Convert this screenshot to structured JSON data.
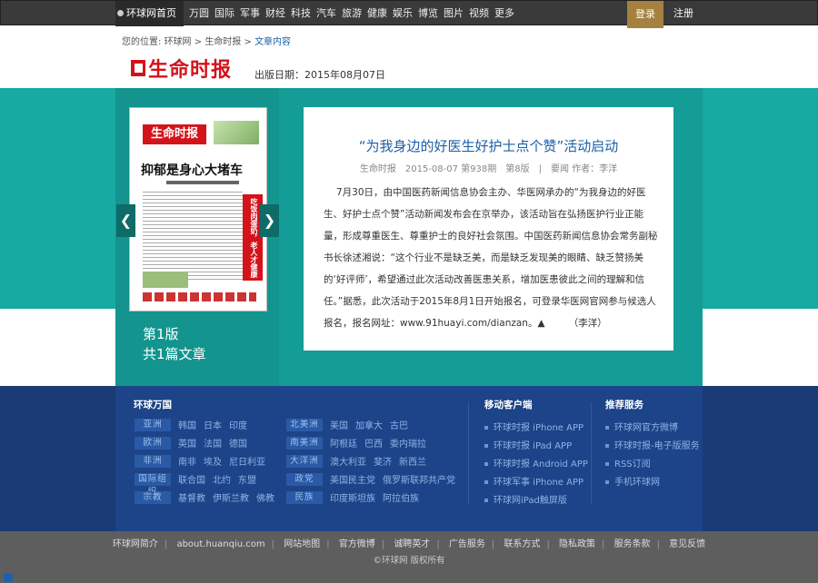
{
  "topbar": {
    "home": "环球网首页",
    "nav": [
      "万圆",
      "国际",
      "军事",
      "财经",
      "科技",
      "汽车",
      "旅游",
      "健康",
      "娱乐",
      "博览",
      "图片",
      "视频"
    ],
    "more": "更多",
    "login": "登录",
    "register": "注册"
  },
  "breadcrumb": {
    "prefix": "您的位置:",
    "items": [
      "环球网",
      "生命时报",
      "文章内容"
    ]
  },
  "logo_text": "生命时报",
  "pubdate": "出版日期：2015年08月07日",
  "paper": {
    "masthead": "生命时报",
    "headline": "抑郁是身心大堵车",
    "redbox": "吃饭肉蛋奶，老人才健康"
  },
  "edition": {
    "page": "第1版",
    "count": "共1篇文章"
  },
  "article": {
    "title": "“为我身边的好医生好护士点个赞”活动启动",
    "meta": "生命时报　2015-08-07 第938期　第8版　|　要闻 作者：李洋",
    "body": "7月30日，由中国医药新闻信息协会主办、华医网承办的“为我身边的好医生、好护士点个赞”活动新闻发布会在京举办，该活动旨在弘扬医护行业正能量，形成尊重医生、尊重护士的良好社会氛围。中国医药新闻信息协会常务副秘书长徐述湘说：“这个行业不是缺乏美，而是缺乏发现美的眼睛、缺乏赞扬美的‘好评师’，希望通过此次活动改善医患关系，增加医患彼此之间的理解和信任。”据悉，此次活动于2015年8月1日开始报名，可登录华医网官网参与候选人报名，报名网址：www.91huayi.com/dianzan。▲　　　（李洋）"
  },
  "footer": {
    "world": {
      "title": "环球万国",
      "rows": [
        {
          "tag": "亚洲",
          "items": [
            "韩国",
            "日本",
            "印度"
          ]
        },
        {
          "tag": "欧洲",
          "items": [
            "英国",
            "法国",
            "德国"
          ]
        },
        {
          "tag": "非洲",
          "items": [
            "南非",
            "埃及",
            "尼日利亚"
          ]
        },
        {
          "tag": "国际组织",
          "items": [
            "联合国",
            "北约",
            "东盟"
          ]
        },
        {
          "tag": "宗教",
          "items": [
            "基督教",
            "伊斯兰教",
            "佛教"
          ]
        }
      ],
      "rows2": [
        {
          "tag": "北美洲",
          "items": [
            "美国",
            "加拿大",
            "古巴"
          ]
        },
        {
          "tag": "南美洲",
          "items": [
            "阿根廷",
            "巴西",
            "委内瑞拉"
          ]
        },
        {
          "tag": "大洋洲",
          "items": [
            "澳大利亚",
            "斐济",
            "新西兰"
          ]
        },
        {
          "tag": "政党",
          "items": [
            "美国民主党",
            "俄罗斯联邦共产党"
          ]
        },
        {
          "tag": "民族",
          "items": [
            "印度斯坦族",
            "阿拉伯族"
          ]
        }
      ]
    },
    "mobile": {
      "title": "移动客户端",
      "items": [
        "环球时报 iPhone APP",
        "环球时报 iPad APP",
        "环球时报 Android APP",
        "环球军事 iPhone APP",
        "环球网iPad触屏版"
      ]
    },
    "recommend": {
      "title": "推荐服务",
      "items": [
        "环球网官方微博",
        "环球时报-电子版服务",
        "RSS订阅",
        "手机环球网"
      ]
    }
  },
  "bottom": {
    "links": [
      "环球网简介",
      "about.huanqiu.com",
      "网站地图",
      "官方微博",
      "诚聘英才",
      "广告服务",
      "联系方式",
      "隐私政策",
      "服务条款",
      "意见反馈"
    ],
    "copyright": "©环球网 版权所有"
  }
}
